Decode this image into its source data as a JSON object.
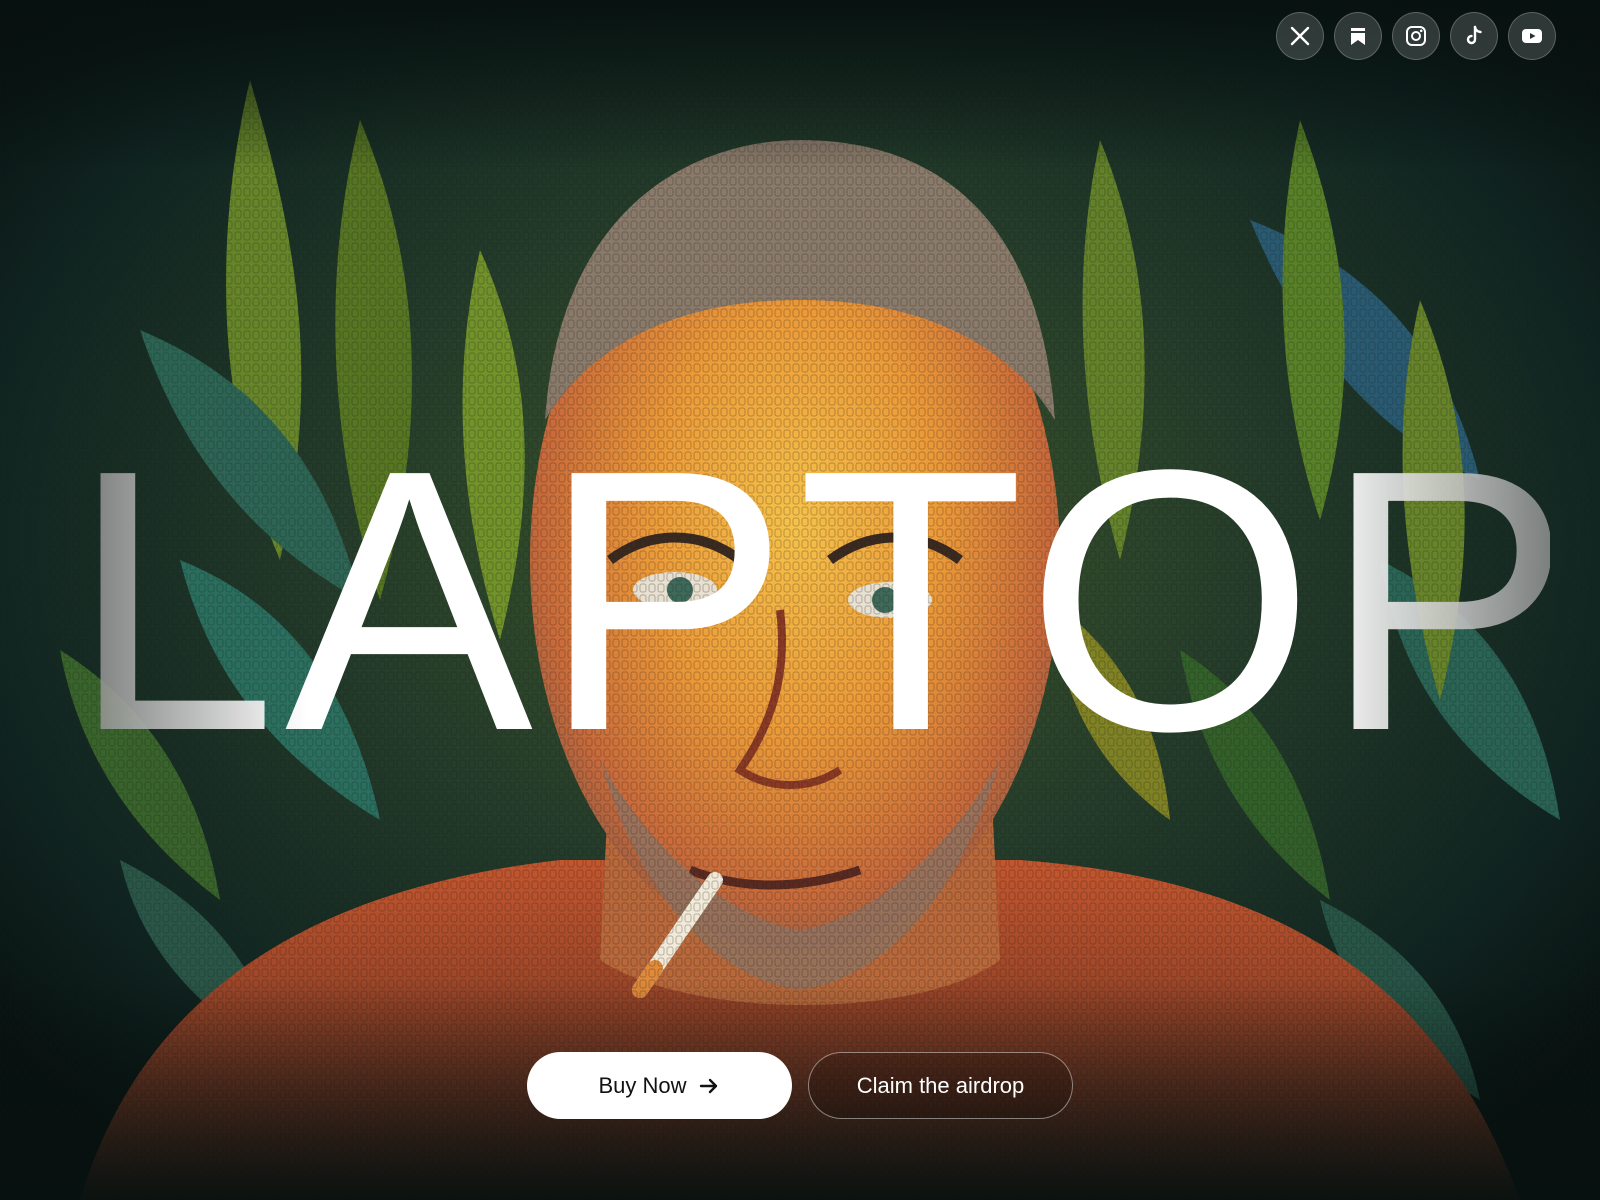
{
  "hero": {
    "title": "LAPTOP"
  },
  "socials": [
    {
      "icon": "x-icon",
      "label": "X"
    },
    {
      "icon": "bookmark-icon",
      "label": "Bookmark"
    },
    {
      "icon": "instagram-icon",
      "label": "Instagram"
    },
    {
      "icon": "tiktok-icon",
      "label": "TikTok"
    },
    {
      "icon": "youtube-icon",
      "label": "YouTube"
    }
  ],
  "cta": {
    "buy_label": "Buy Now",
    "claim_label": "Claim the airdrop"
  },
  "colors": {
    "background": "#0a1612",
    "button_primary_bg": "#ffffff",
    "button_primary_text": "#111111",
    "text": "#ffffff"
  }
}
